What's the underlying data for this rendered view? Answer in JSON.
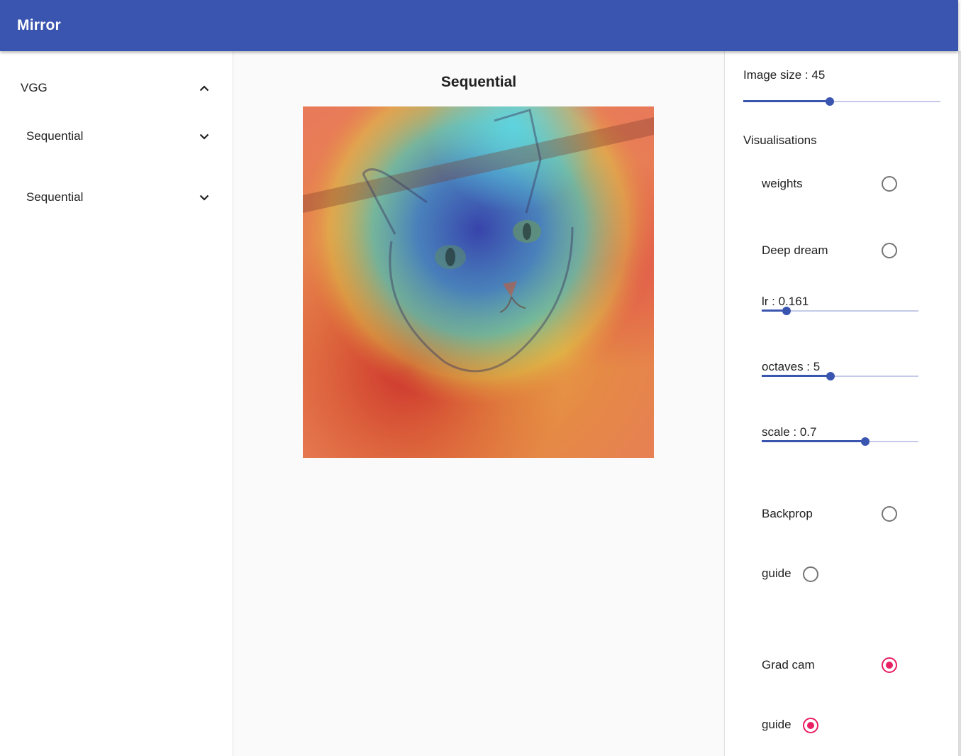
{
  "app": {
    "title": "Mirror"
  },
  "sidebar": {
    "items": [
      {
        "label": "VGG",
        "icon": "chevron-up-icon",
        "expanded": true
      },
      {
        "label": "Sequential",
        "icon": "chevron-down-icon",
        "expanded": false
      },
      {
        "label": "Sequential",
        "icon": "chevron-down-icon",
        "expanded": false
      }
    ]
  },
  "main": {
    "title": "Sequential"
  },
  "settings": {
    "image_size": {
      "label": "Image size : 45",
      "value_fraction": 0.44
    },
    "section_label": "Visualisations",
    "weights": {
      "label": "weights",
      "selected": false
    },
    "deep_dream": {
      "label": "Deep dream",
      "selected": false,
      "lr": {
        "label": "lr : 0.161",
        "value_fraction": 0.16
      },
      "octaves": {
        "label": "octaves : 5",
        "value_fraction": 0.44
      },
      "scale": {
        "label": "scale : 0.7",
        "value_fraction": 0.66
      }
    },
    "backprop": {
      "label": "Backprop",
      "selected": false,
      "guide_label": "guide",
      "guide_selected": false
    },
    "grad_cam": {
      "label": "Grad cam",
      "selected": true,
      "guide_label": "guide",
      "guide_selected": true
    }
  },
  "colors": {
    "primary": "#3a55b0",
    "accent": "#e91e63"
  }
}
